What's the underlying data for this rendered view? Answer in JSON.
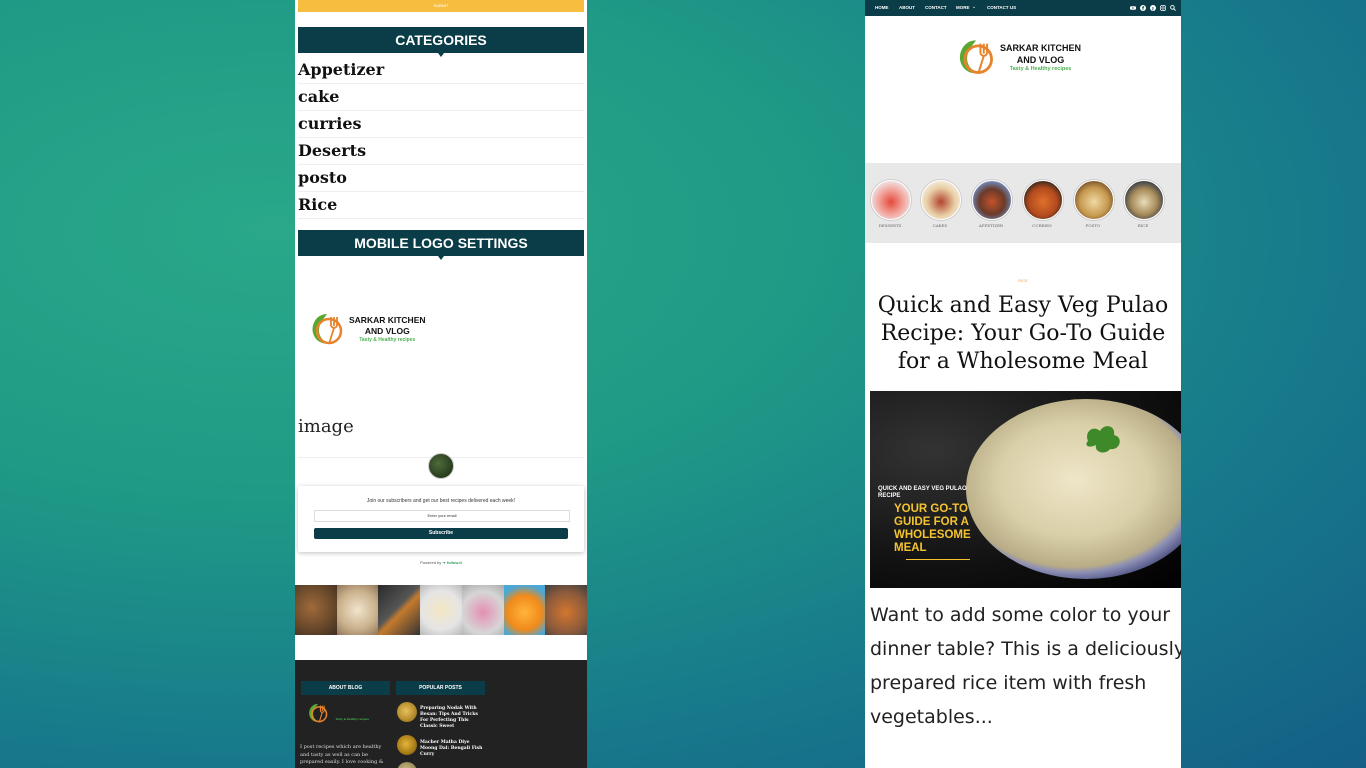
{
  "left": {
    "top_button": "SUBMIT",
    "categories_title": "CATEGORIES",
    "categories": [
      "Appetizer",
      "cake",
      "curries",
      "Deserts",
      "posto",
      "Rice"
    ],
    "mobile_logo_title": "MOBILE LOGO SETTINGS",
    "logo": {
      "line1": "SARKAR KITCHEN",
      "line2": "AND VLOG",
      "tagline": "Tasty & Healthy recipes"
    },
    "image_label": "image",
    "subscribe": {
      "text": "Join our subscribers and get our best recipes delivered each week!",
      "placeholder": "Enter your email",
      "button": "Subscribe",
      "powered_by": "Powered by",
      "powered_brand": "follow.it"
    },
    "footer": {
      "about_title": "ABOUT BLOG",
      "popular_title": "POPULAR POSTS",
      "about_text": "I post recipes which are healthy and tasty as well as can be prepared easily. I love cooking &",
      "posts": [
        "Preparing Nodak With Besan: Tips And Tricks For Perfecting This Classic Sweet",
        "Macher Matha Diye Moong Dal: Bengali Fish Curry"
      ]
    }
  },
  "right": {
    "nav": [
      "HOME",
      "ABOUT",
      "CONTACT",
      "MORE",
      "CONTACT US"
    ],
    "nav_icons": [
      "youtube-icon",
      "facebook-icon",
      "pinterest-icon",
      "instagram-icon",
      "search-icon"
    ],
    "logo": {
      "line1": "SARKAR KITCHEN",
      "line2": "AND VLOG",
      "tagline": "Tasty & Healthy recipes"
    },
    "category_circles": [
      "DESSERTS",
      "CAKES",
      "APPETIZER",
      "CURRIES",
      "POSTO",
      "RICE"
    ],
    "post_category": "RICE",
    "post_title": "Quick and Easy Veg Pulao Recipe: Your Go-To Guide for a Wholesome Meal",
    "hero": {
      "small_title": "QUICK AND EASY VEG PULAO RECIPE",
      "big_title": "YOUR GO-TO GUIDE FOR A WHOLESOME MEAL"
    },
    "excerpt": "Want to add some color to your dinner table? This is a deliciously prepared rice item with fresh vegetables..."
  },
  "colors": {
    "teal_dark": "#0b3d48",
    "yellow": "#f7bd3f",
    "green_tag": "#4caf50",
    "orange": "#f0a35a"
  }
}
